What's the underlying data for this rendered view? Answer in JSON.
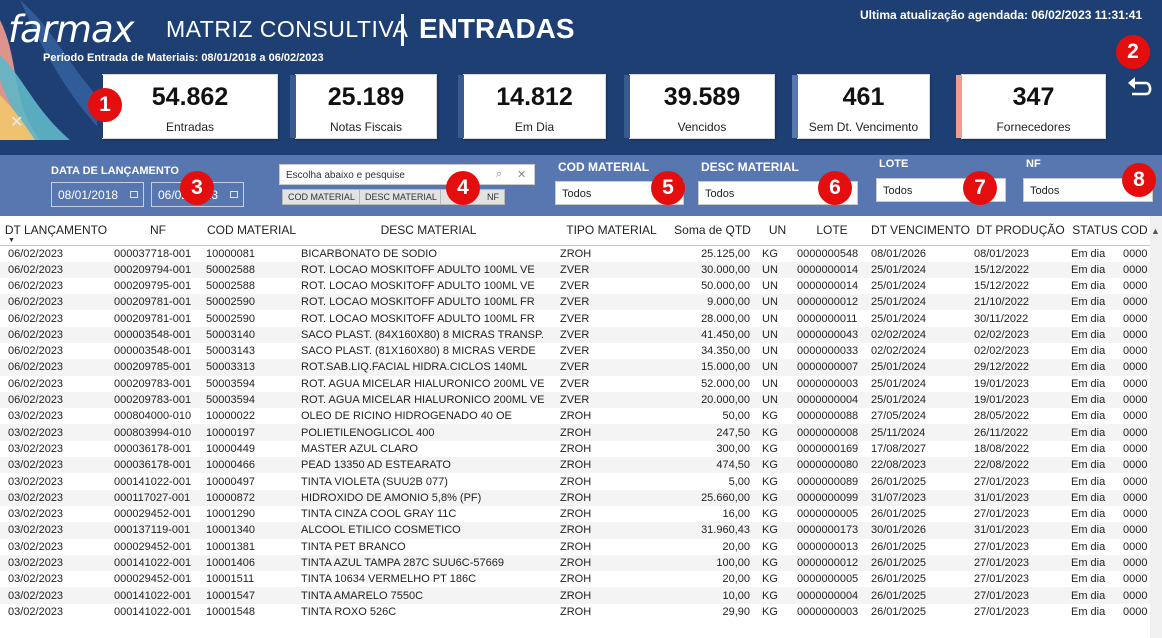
{
  "header": {
    "logo": "farmax",
    "title_main": "MATRIZ CONSULTIVA",
    "title_strong": "ENTRADAS",
    "period": "Período Entrada de Materiais: 08/01/2018 a 06/02/2023",
    "last_update": "Ultima atualização agendada: 06/02/2023 11:31:41"
  },
  "kpis": [
    {
      "value": "54.862",
      "label": "Entradas",
      "accent": "#1e3f74"
    },
    {
      "value": "25.189",
      "label": "Notas Fiscais",
      "accent": "#1e3f74"
    },
    {
      "value": "14.812",
      "label": "Em Dia",
      "accent": "#1e3f74"
    },
    {
      "value": "39.589",
      "label": "Vencidos",
      "accent": "#1e3f74"
    },
    {
      "value": "461",
      "label": "Sem Dt. Vencimento",
      "accent": "#5877b1"
    },
    {
      "value": "347",
      "label": "Fornecedores",
      "accent": "#f09c8e"
    }
  ],
  "badges": [
    "1",
    "2",
    "3",
    "4",
    "5",
    "6",
    "7",
    "8"
  ],
  "icons": {
    "back": "return-arrow-icon",
    "filter": "funnel-icon",
    "search": "search-icon",
    "clear": "close-icon",
    "calendar": "calendar-icon"
  },
  "filters": {
    "date_label": "DATA DE LANÇAMENTO",
    "date_from": "08/01/2018",
    "date_to": "06/02/2023",
    "search_placeholder": "Escolha abaixo e pesquise",
    "mode_buttons": [
      "COD MATERIAL",
      "DESC MATERIAL",
      "NF"
    ],
    "cod_material_label": "COD MATERIAL",
    "cod_material_value": "Todos",
    "desc_material_label": "DESC MATERIAL",
    "desc_material_value": "Todos",
    "lote_label": "LOTE",
    "lote_value": "Todos",
    "nf_label": "NF",
    "nf_value": "Todos"
  },
  "table": {
    "columns": [
      "DT LANÇAMENTO",
      "NF",
      "COD MATERIAL",
      "DESC MATERIAL",
      "TIPO MATERIAL",
      "Soma de QTD",
      "UN",
      "LOTE",
      "DT VENCIMENTO",
      "DT PRODUÇÃO",
      "STATUS",
      "COD"
    ],
    "rows": [
      [
        "06/02/2023",
        "000037718-001",
        "10000081",
        "BICARBONATO DE SODIO",
        "ZROH",
        "25.125,00",
        "KG",
        "0000000548",
        "08/01/2026",
        "08/01/2023",
        "Em dia",
        "0000"
      ],
      [
        "06/02/2023",
        "000209794-001",
        "50002588",
        "ROT. LOCAO MOSKITOFF ADULTO 100ML VE",
        "ZVER",
        "30.000,00",
        "UN",
        "0000000014",
        "25/01/2024",
        "15/12/2022",
        "Em dia",
        "0000"
      ],
      [
        "06/02/2023",
        "000209795-001",
        "50002588",
        "ROT. LOCAO MOSKITOFF ADULTO 100ML VE",
        "ZVER",
        "50.000,00",
        "UN",
        "0000000014",
        "25/01/2024",
        "15/12/2022",
        "Em dia",
        "0000"
      ],
      [
        "06/02/2023",
        "000209781-001",
        "50002590",
        "ROT. LOCAO MOSKITOFF ADULTO 100ML FR",
        "ZVER",
        "9.000,00",
        "UN",
        "0000000012",
        "25/01/2024",
        "21/10/2022",
        "Em dia",
        "0000"
      ],
      [
        "06/02/2023",
        "000209781-001",
        "50002590",
        "ROT. LOCAO MOSKITOFF ADULTO 100ML FR",
        "ZVER",
        "28.000,00",
        "UN",
        "0000000011",
        "25/01/2024",
        "30/11/2022",
        "Em dia",
        "0000"
      ],
      [
        "06/02/2023",
        "000003548-001",
        "50003140",
        "SACO PLAST. (84X160X80) 8 MICRAS TRANSP.",
        "ZVER",
        "41.450,00",
        "UN",
        "0000000043",
        "02/02/2024",
        "02/02/2023",
        "Em dia",
        "0000"
      ],
      [
        "06/02/2023",
        "000003548-001",
        "50003143",
        "SACO PLAST. (81X160X80) 8 MICRAS VERDE",
        "ZVER",
        "34.350,00",
        "UN",
        "0000000033",
        "02/02/2024",
        "02/02/2023",
        "Em dia",
        "0000"
      ],
      [
        "06/02/2023",
        "000209785-001",
        "50003313",
        "ROT.SAB.LIQ.FACIAL HIDRA.CICLOS 140ML",
        "ZVER",
        "15.000,00",
        "UN",
        "0000000007",
        "25/01/2024",
        "29/12/2022",
        "Em dia",
        "0000"
      ],
      [
        "06/02/2023",
        "000209783-001",
        "50003594",
        "ROT. AGUA MICELAR HIALURONICO 200ML VE",
        "ZVER",
        "52.000,00",
        "UN",
        "0000000003",
        "25/01/2024",
        "19/01/2023",
        "Em dia",
        "0000"
      ],
      [
        "06/02/2023",
        "000209783-001",
        "50003594",
        "ROT. AGUA MICELAR HIALURONICO 200ML VE",
        "ZVER",
        "20.000,00",
        "UN",
        "0000000004",
        "25/01/2024",
        "19/01/2023",
        "Em dia",
        "0000"
      ],
      [
        "03/02/2023",
        "000804000-010",
        "10000022",
        "OLEO DE RICINO HIDROGENADO 40 OE",
        "ZROH",
        "50,00",
        "KG",
        "0000000088",
        "27/05/2024",
        "28/05/2022",
        "Em dia",
        "0000"
      ],
      [
        "03/02/2023",
        "000803994-010",
        "10000197",
        "POLIETILENOGLICOL 400",
        "ZROH",
        "247,50",
        "KG",
        "0000000008",
        "25/11/2024",
        "26/11/2022",
        "Em dia",
        "0000"
      ],
      [
        "03/02/2023",
        "000036178-001",
        "10000449",
        "MASTER AZUL CLARO",
        "ZROH",
        "300,00",
        "KG",
        "0000000169",
        "17/08/2027",
        "18/08/2022",
        "Em dia",
        "0000"
      ],
      [
        "03/02/2023",
        "000036178-001",
        "10000466",
        "PEAD 13350 AD ESTEARATO",
        "ZROH",
        "474,50",
        "KG",
        "0000000080",
        "22/08/2023",
        "22/08/2022",
        "Em dia",
        "0000"
      ],
      [
        "03/02/2023",
        "000141022-001",
        "10000497",
        "TINTA VIOLETA (SUU2B 077)",
        "ZROH",
        "5,00",
        "KG",
        "0000000089",
        "26/01/2025",
        "27/01/2023",
        "Em dia",
        "0000"
      ],
      [
        "03/02/2023",
        "000117027-001",
        "10000872",
        "HIDROXIDO DE AMONIO 5,8% (PF)",
        "ZROH",
        "25.660,00",
        "KG",
        "0000000099",
        "31/07/2023",
        "31/01/2023",
        "Em dia",
        "0000"
      ],
      [
        "03/02/2023",
        "000029452-001",
        "10001290",
        "TINTA CINZA COOL GRAY 11C",
        "ZROH",
        "16,00",
        "KG",
        "0000000005",
        "26/01/2025",
        "27/01/2023",
        "Em dia",
        "0000"
      ],
      [
        "03/02/2023",
        "000137119-001",
        "10001340",
        "ALCOOL ETILICO COSMETICO",
        "ZROH",
        "31.960,43",
        "KG",
        "0000000173",
        "30/01/2026",
        "31/01/2023",
        "Em dia",
        "0000"
      ],
      [
        "03/02/2023",
        "000029452-001",
        "10001381",
        "TINTA PET BRANCO",
        "ZROH",
        "20,00",
        "KG",
        "0000000013",
        "26/01/2025",
        "27/01/2023",
        "Em dia",
        "0000"
      ],
      [
        "03/02/2023",
        "000141022-001",
        "10001406",
        "TINTA AZUL TAMPA  287C SUU6C-57669",
        "ZROH",
        "100,00",
        "KG",
        "0000000012",
        "26/01/2025",
        "27/01/2023",
        "Em dia",
        "0000"
      ],
      [
        "03/02/2023",
        "000029452-001",
        "10001511",
        "TINTA 10634 VERMELHO PT 186C",
        "ZROH",
        "20,00",
        "KG",
        "0000000005",
        "26/01/2025",
        "27/01/2023",
        "Em dia",
        "0000"
      ],
      [
        "03/02/2023",
        "000141022-001",
        "10001547",
        "TINTA AMARELO 7550C",
        "ZROH",
        "10,00",
        "KG",
        "0000000004",
        "26/01/2025",
        "27/01/2023",
        "Em dia",
        "0000"
      ],
      [
        "03/02/2023",
        "000141022-001",
        "10001548",
        "TINTA ROXO 526C",
        "ZROH",
        "29,90",
        "KG",
        "0000000003",
        "26/01/2025",
        "27/01/2023",
        "Em dia",
        "0000"
      ]
    ]
  }
}
